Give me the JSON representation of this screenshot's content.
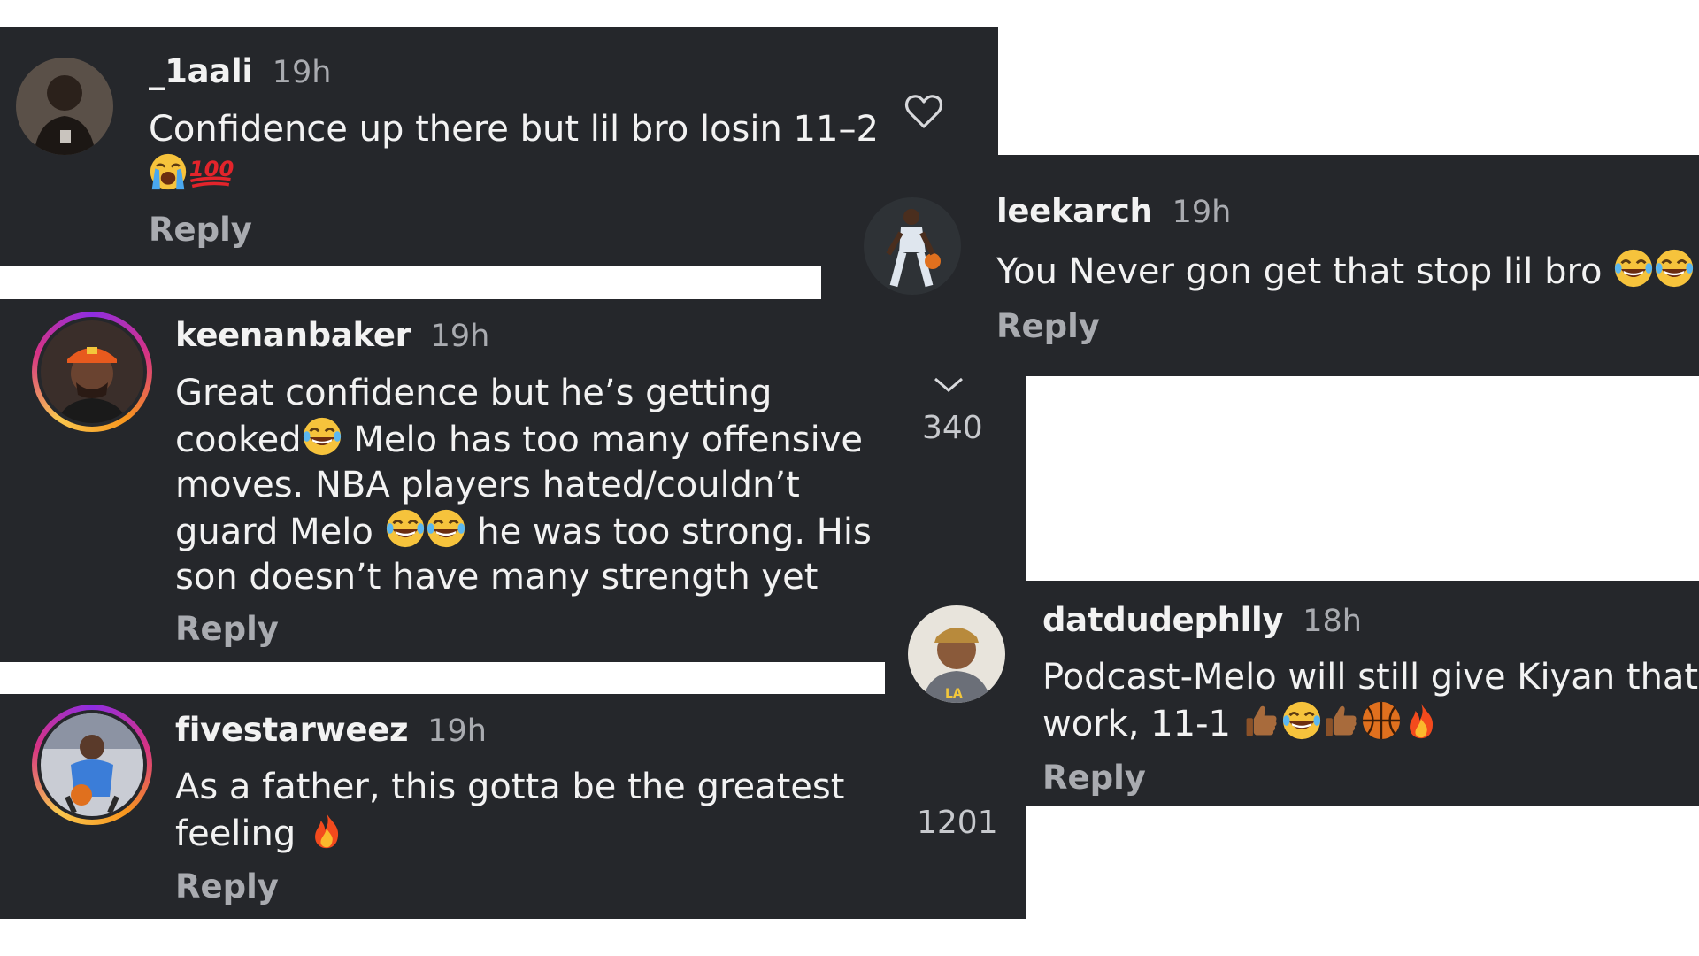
{
  "comments": [
    {
      "id": "1aali",
      "username": "_1aali",
      "time": "19h",
      "text": "Confidence up there but lil bro losin 11–2",
      "emoji": [
        "loudly-crying-face",
        "hundred-points"
      ],
      "reply": "Reply"
    },
    {
      "id": "keenanbaker",
      "username": "keenanbaker",
      "time": "19h",
      "lines": [
        "Great confidence but he’s getting",
        "cooked",
        " Melo has too many offensive",
        "moves. NBA players hated/couldn’t",
        "guard Melo ",
        " he was too strong. His",
        "son doesn’t have many strength yet"
      ],
      "reply": "Reply",
      "like_count": "340"
    },
    {
      "id": "fivestarweez",
      "username": "fivestarweez",
      "time": "19h",
      "lines": [
        "As a father, this gotta be the greatest",
        "feeling "
      ],
      "reply": "Reply",
      "like_count": "1201"
    },
    {
      "id": "leekarch",
      "username": "leekarch",
      "time": "19h",
      "text": "You Never gon get that stop lil bro ",
      "reply": "Reply"
    },
    {
      "id": "datdudephlly",
      "username": "datdudephlly",
      "time": "18h",
      "lines": [
        "Podcast-Melo will still give Kiyan that",
        "work, 11-1 "
      ],
      "reply": "Reply"
    }
  ],
  "icons": {
    "like": "heart-outline-icon",
    "collapse": "chevron-down-icon"
  },
  "colors": {
    "panel_bg": "#25272b",
    "username": "#f2f2f2",
    "meta": "#a9abb0",
    "ring": [
      "#8e2de2",
      "#d63384",
      "#f8961e",
      "#f9c74f"
    ]
  }
}
